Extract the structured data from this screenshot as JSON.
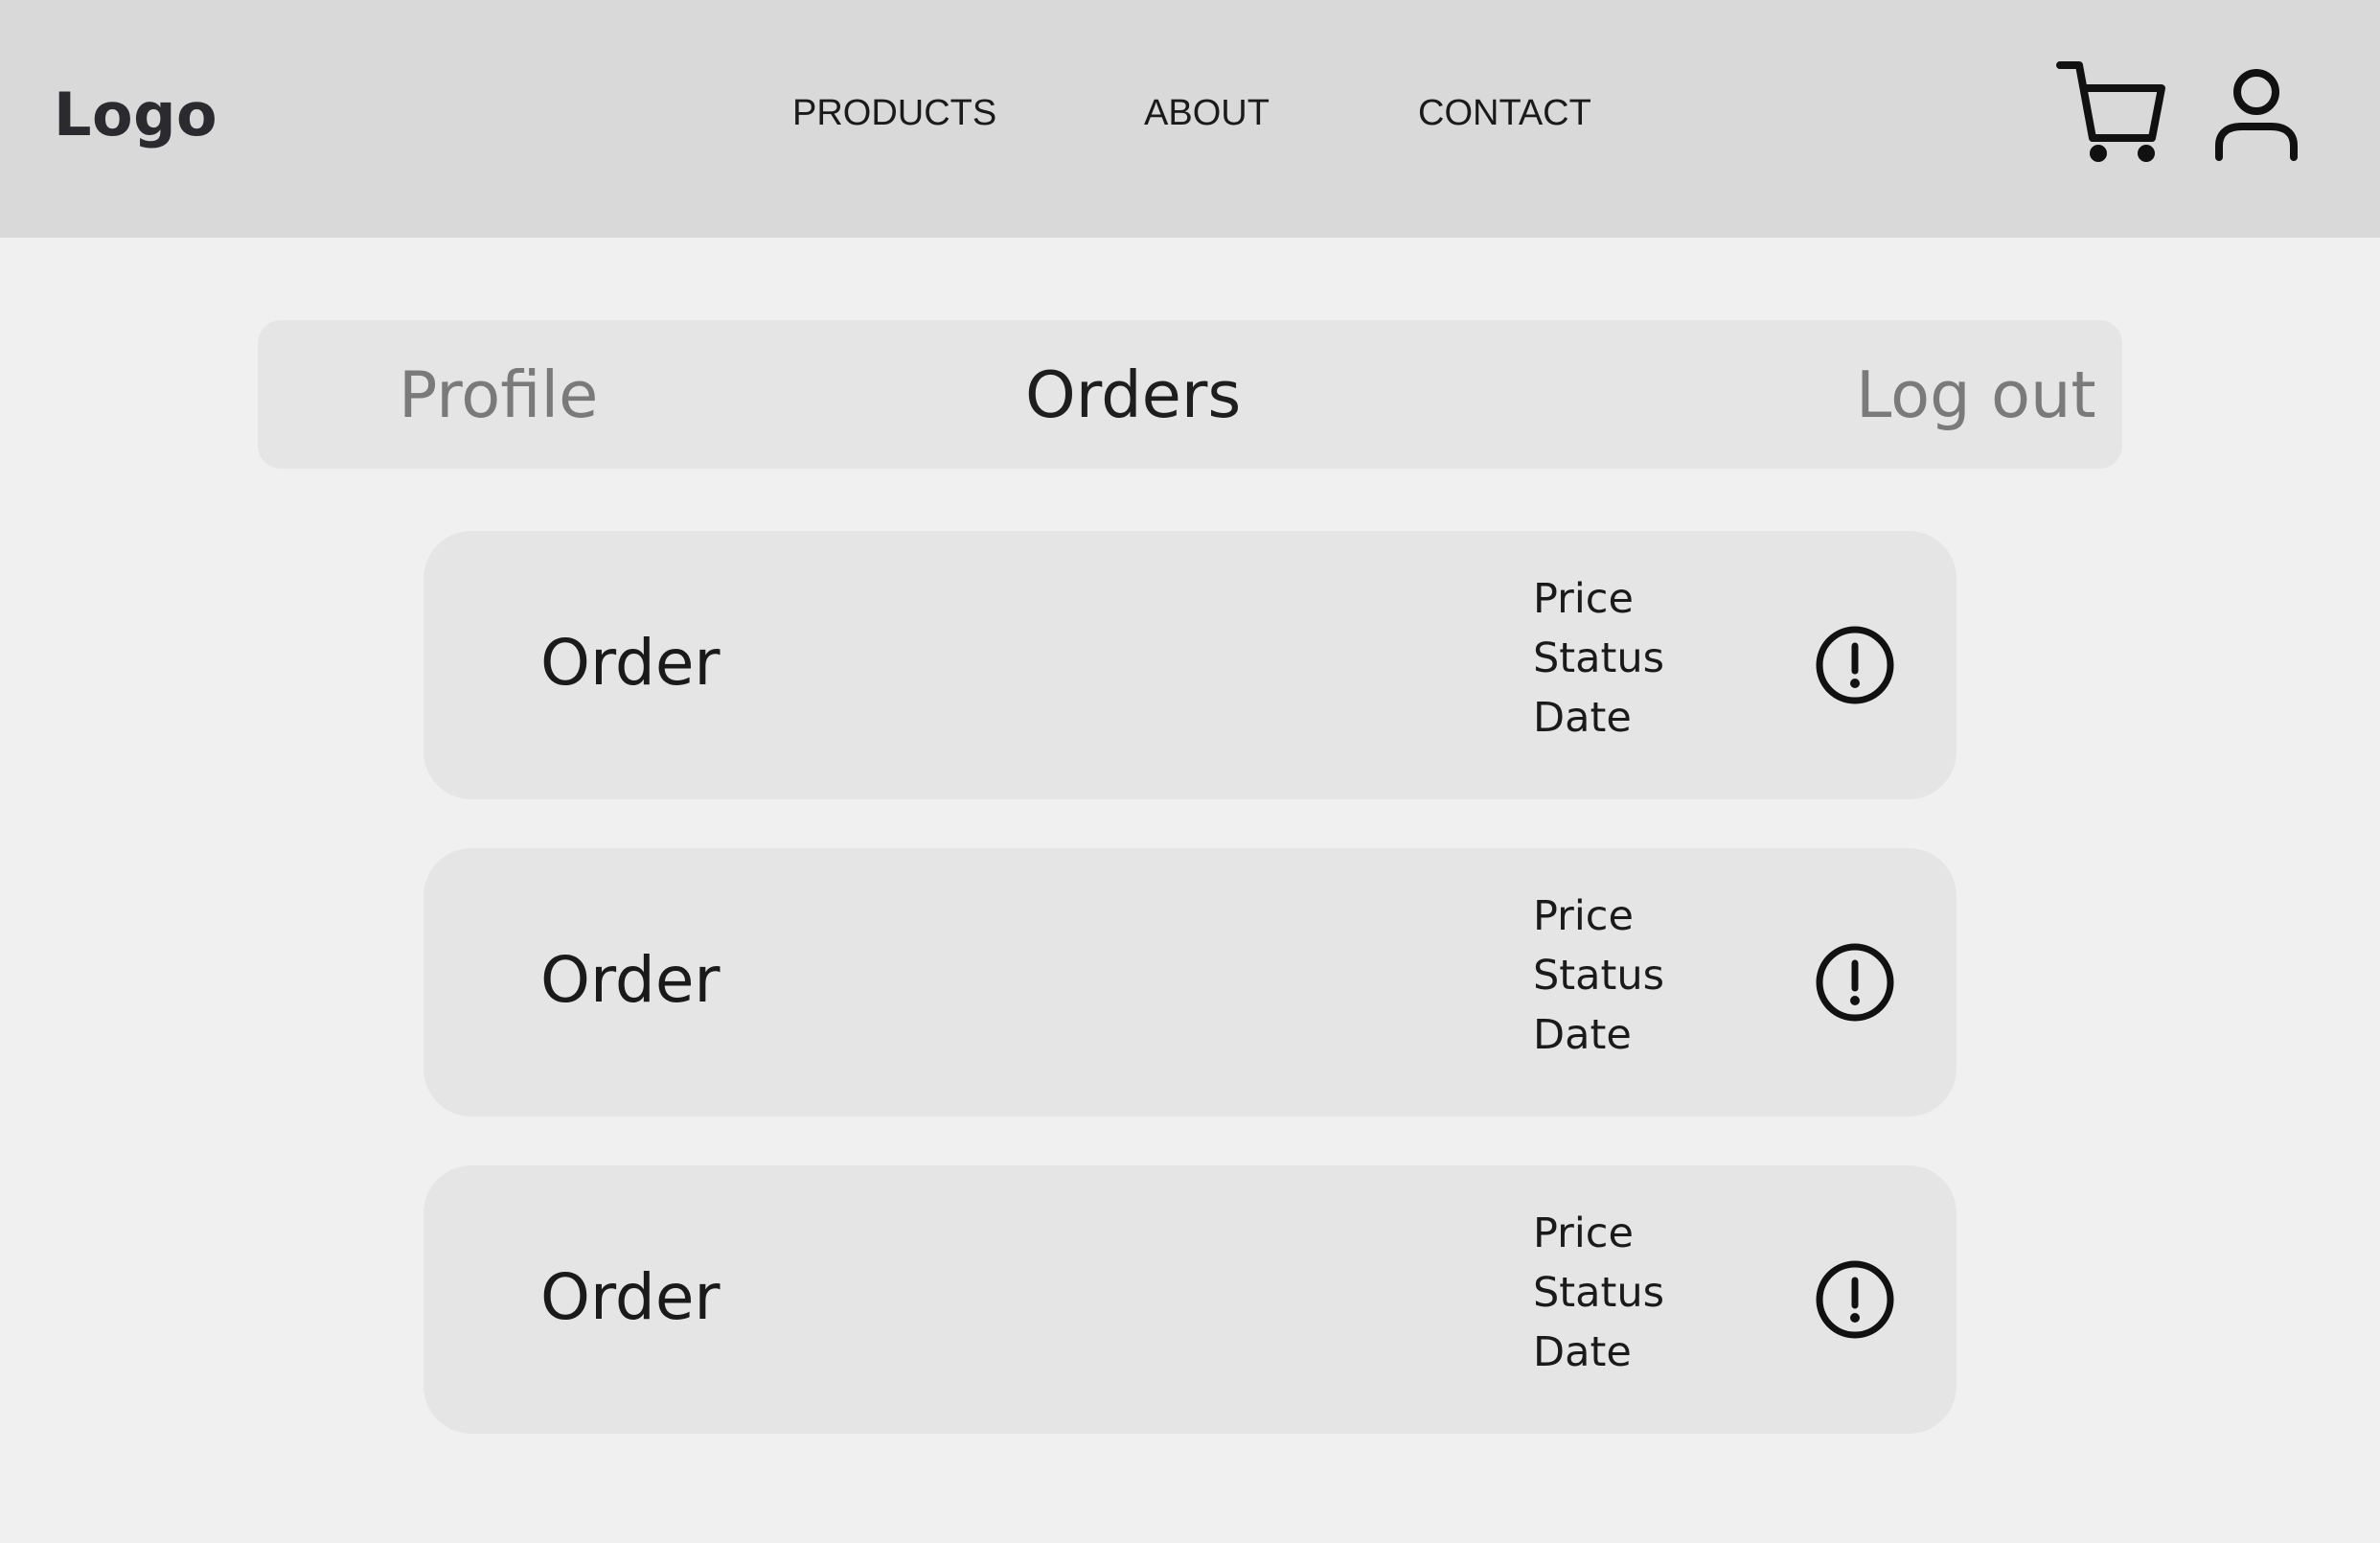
{
  "header": {
    "logo": "Logo",
    "nav": [
      {
        "label": "PRODUCTS"
      },
      {
        "label": "ABOUT"
      },
      {
        "label": "CONTACT"
      }
    ],
    "icons": {
      "cart": "cart-icon",
      "user": "user-icon"
    },
    "colors": {
      "background": "#d9d9d9",
      "text": "#2b2b2f"
    }
  },
  "account_tabs": {
    "items": [
      {
        "label": "Profile",
        "active": false
      },
      {
        "label": "Orders",
        "active": true
      },
      {
        "label": "Log out",
        "active": false
      }
    ]
  },
  "orders": [
    {
      "title": "Order",
      "price": "Price",
      "status": "Status",
      "date": "Date",
      "icon": "exclamation-circle-icon"
    },
    {
      "title": "Order",
      "price": "Price",
      "status": "Status",
      "date": "Date",
      "icon": "exclamation-circle-icon"
    },
    {
      "title": "Order",
      "price": "Price",
      "status": "Status",
      "date": "Date",
      "icon": "exclamation-circle-icon"
    }
  ],
  "colors": {
    "page_background": "#f0f0f1",
    "panel_background": "#e5e5e5",
    "active_tab_text": "#1e1e1e",
    "inactive_tab_text": "#7a7a7a"
  }
}
